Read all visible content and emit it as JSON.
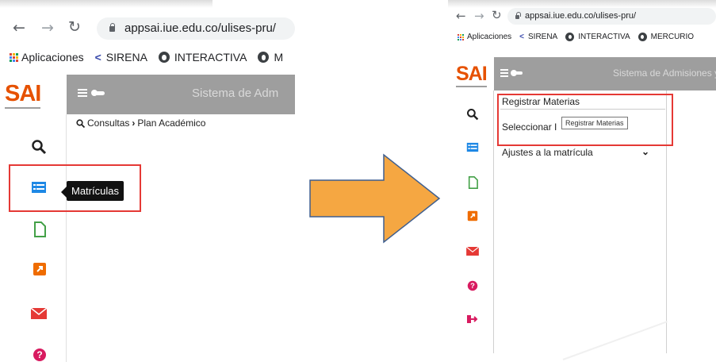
{
  "left": {
    "browser": {
      "url": "appsai.iue.edu.co/ulises-pru/",
      "bookmarks": [
        "Aplicaciones",
        "SIRENA",
        "INTERACTIVA",
        "M"
      ]
    },
    "app": {
      "logo": "SAI",
      "title": "Sistema de Adm"
    },
    "breadcrumb": {
      "root": "Consultas",
      "current": "Plan Académico"
    },
    "tooltip": "Matrículas"
  },
  "right": {
    "browser": {
      "url": "appsai.iue.edu.co/ulises-pru/",
      "bookmarks": [
        "Aplicaciones",
        "SIRENA",
        "INTERACTIVA",
        "MERCURIO"
      ]
    },
    "app": {
      "logo": "SAI",
      "title": "Sistema de Admisiones y"
    },
    "menu": {
      "items": [
        "Registrar Materias",
        "Seleccionar I",
        "Ajustes a la matrícula"
      ],
      "tooltip": "Registrar Materias"
    }
  },
  "colors": {
    "accent_red": "#e53935",
    "arrow_orange": "#f5a742",
    "arrow_outline": "#3f5f8f",
    "appbar_gray": "#9e9e9e",
    "logo_orange": "#e65100"
  },
  "icons": {
    "sidebar": [
      "search-icon",
      "list-icon",
      "document-icon",
      "external-link-icon",
      "mail-icon",
      "help-icon",
      "logout-icon"
    ]
  }
}
